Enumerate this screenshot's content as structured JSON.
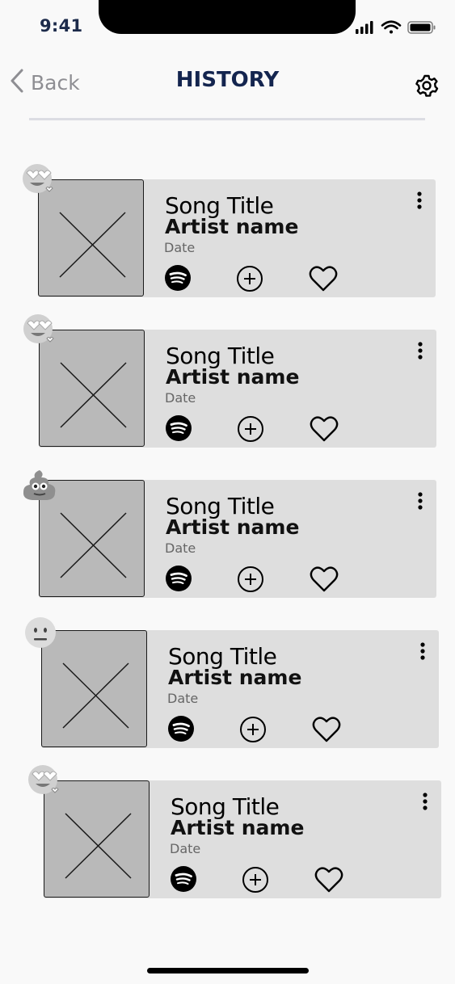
{
  "status_bar": {
    "time": "9:41"
  },
  "header": {
    "back_label": "Back",
    "title": "HISTORY"
  },
  "songs": [
    {
      "title": "Song Title",
      "artist": "Artist name",
      "date": "Date",
      "emoji": "heart-eyes-emoji-icon"
    },
    {
      "title": "Song Title",
      "artist": "Artist name",
      "date": "Date",
      "emoji": "heart-eyes-emoji-icon"
    },
    {
      "title": "Song Title",
      "artist": "Artist name",
      "date": "Date",
      "emoji": "poop-emoji-icon"
    },
    {
      "title": "Song Title",
      "artist": "Artist name",
      "date": "Date",
      "emoji": "neutral-face-emoji-icon"
    },
    {
      "title": "Song Title",
      "artist": "Artist name",
      "date": "Date",
      "emoji": "heart-eyes-emoji-icon"
    }
  ],
  "colors": {
    "title": "#14254f",
    "card": "#dedede",
    "thumb": "#b9b9b9"
  }
}
